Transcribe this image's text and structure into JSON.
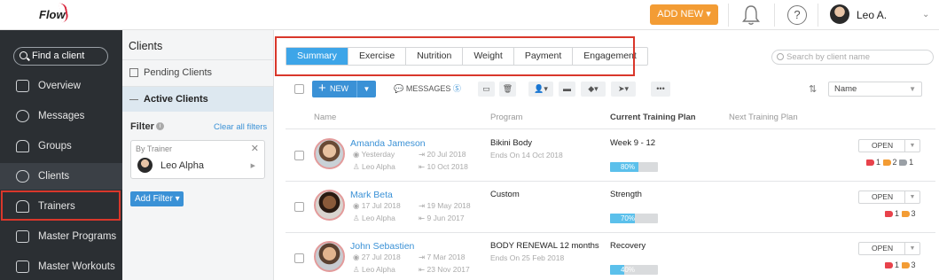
{
  "topbar": {
    "logo": "Flow",
    "add_new": "ADD NEW ▾",
    "help": "?",
    "user_name": "Leo A."
  },
  "sidebar": {
    "find_client": "Find a client",
    "items": [
      {
        "label": "Overview",
        "icon": "monitor-icon"
      },
      {
        "label": "Messages",
        "icon": "chat-bubbles-icon"
      },
      {
        "label": "Groups",
        "icon": "people-icon"
      },
      {
        "label": "Clients",
        "icon": "clients-icon",
        "active": true
      },
      {
        "label": "Trainers",
        "icon": "trainer-icon"
      },
      {
        "label": "Master Programs",
        "icon": "book-icon"
      },
      {
        "label": "Master Workouts",
        "icon": "document-icon"
      }
    ]
  },
  "clients_panel": {
    "title": "Clients",
    "pending": "Pending Clients",
    "active": "Active Clients",
    "filter_label": "Filter",
    "clear_all": "Clear all filters",
    "trainer_filter": {
      "label": "By Trainer",
      "value": "Leo Alpha"
    },
    "add_filter": "Add Filter ▾"
  },
  "tabs": [
    "Summary",
    "Exercise",
    "Nutrition",
    "Weight",
    "Payment",
    "Engagement"
  ],
  "search": {
    "placeholder": "Search by client name"
  },
  "toolbar": {
    "new": "NEW",
    "messages": "MESSAGES",
    "sort": "Name"
  },
  "columns": {
    "name": "Name",
    "program": "Program",
    "current_plan": "Current Training Plan",
    "next_plan": "Next Training Plan"
  },
  "clients": [
    {
      "name": "Amanda Jameson",
      "last_seen": "Yesterday",
      "trainer": "Leo Alpha",
      "date1": "20 Jul 2018",
      "date2": "10 Oct 2018",
      "program": "Bikini Body",
      "program_end": "Ends On 14 Oct 2018",
      "plan": "Week 9 - 12",
      "progress": "80%",
      "progress_value": 0.8,
      "status": "OPEN",
      "tags": [
        {
          "color": "#e8424b",
          "count": "1"
        },
        {
          "color": "#f39c34",
          "count": "2"
        },
        {
          "color": "#9aa0a6",
          "count": "1"
        }
      ]
    },
    {
      "name": "Mark Beta",
      "last_seen": "17 Jul 2018",
      "trainer": "Leo Alpha",
      "date1": "19 May 2018",
      "date2": "9 Jun 2017",
      "program": "Custom",
      "program_end": "",
      "plan": "Strength",
      "progress": "70%",
      "progress_value": 0.7,
      "status": "OPEN",
      "tags": [
        {
          "color": "#e8424b",
          "count": "1"
        },
        {
          "color": "#f39c34",
          "count": "3"
        }
      ]
    },
    {
      "name": "John Sebastien",
      "last_seen": "27 Jul 2018",
      "trainer": "Leo Alpha",
      "date1": "7 Mar 2018",
      "date2": "23 Nov 2017",
      "program": "BODY RENEWAL 12 months",
      "program_end": "Ends On 25 Feb 2018",
      "plan": "Recovery",
      "progress": "40%",
      "progress_value": 0.4,
      "status": "OPEN",
      "tags": [
        {
          "color": "#e8424b",
          "count": "1"
        },
        {
          "color": "#f39c34",
          "count": "3"
        }
      ]
    }
  ]
}
